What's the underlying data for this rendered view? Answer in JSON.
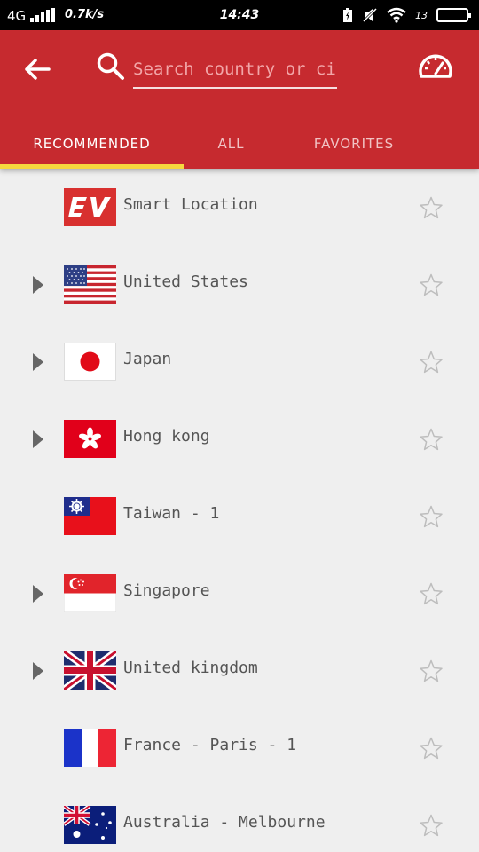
{
  "status_bar": {
    "network": "4G",
    "speed": "0.7k/s",
    "time": "14:43",
    "battery_pct": "13"
  },
  "header": {
    "back_icon": "back-arrow-icon",
    "search_icon": "search-icon",
    "search_placeholder": "Search country or city",
    "speedtest_icon": "speedometer-icon"
  },
  "tabs": [
    {
      "label": "RECOMMENDED",
      "active": true
    },
    {
      "label": "ALL",
      "active": false
    },
    {
      "label": "FAVORITES",
      "active": false
    }
  ],
  "colors": {
    "appbar": "#c62a2f",
    "tab_indicator": "#f6d83e",
    "background": "#efefef"
  },
  "locations": [
    {
      "name": "Smart Location",
      "flag": "expressvpn-logo",
      "expandable": false
    },
    {
      "name": "United States",
      "flag": "us-flag",
      "expandable": true
    },
    {
      "name": "Japan",
      "flag": "japan-flag",
      "expandable": true
    },
    {
      "name": "Hong kong",
      "flag": "hong-kong-flag",
      "expandable": true
    },
    {
      "name": "Taiwan - 1",
      "flag": "taiwan-flag",
      "expandable": false
    },
    {
      "name": "Singapore",
      "flag": "singapore-flag",
      "expandable": true
    },
    {
      "name": "United kingdom",
      "flag": "uk-flag",
      "expandable": true
    },
    {
      "name": "France - Paris - 1",
      "flag": "france-flag",
      "expandable": false
    },
    {
      "name": "Australia - Melbourne",
      "flag": "australia-flag",
      "expandable": false
    }
  ]
}
